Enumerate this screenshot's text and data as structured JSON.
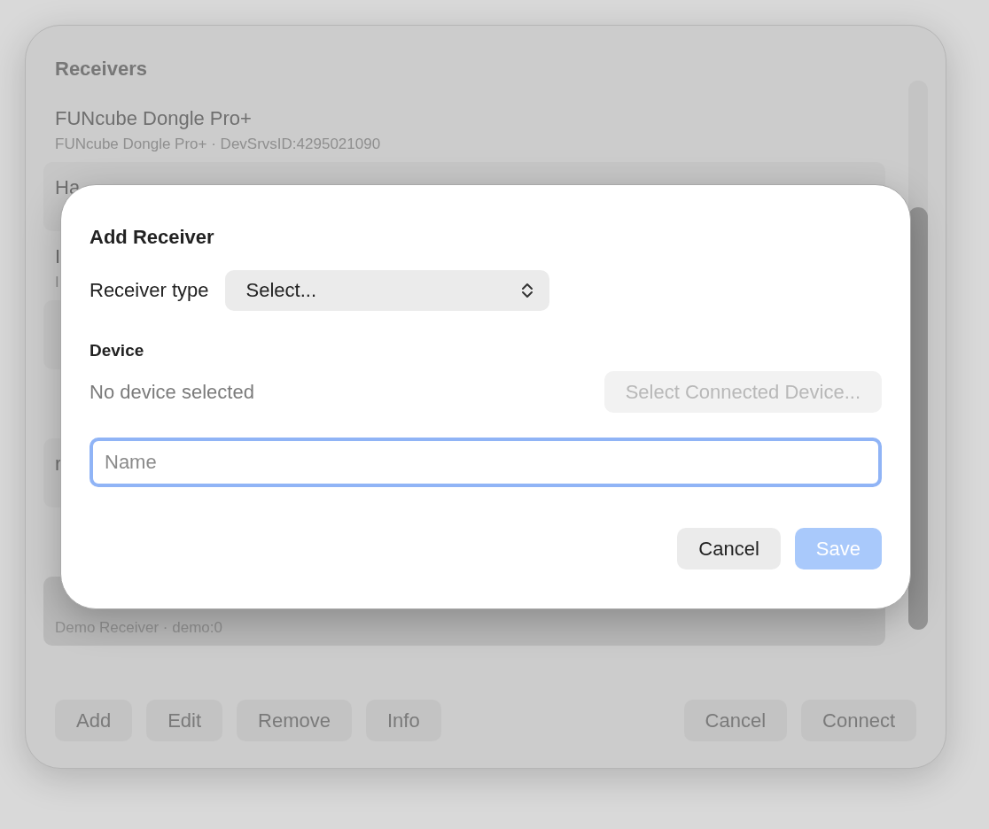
{
  "panel": {
    "title": "Receivers",
    "receivers": [
      {
        "title": "FUNcube Dongle Pro+",
        "subtitle": "FUNcube Dongle Pro+ · DevSrvsID:4295021090",
        "selected": false
      },
      {
        "title": "Ha",
        "selected": false
      },
      {
        "title": "I",
        "subtitle": "I",
        "selected": false
      },
      {
        "selected": false
      },
      {
        "selected": false
      },
      {
        "title": "r",
        "selected": false
      },
      {
        "selected": false
      },
      {
        "subtitle": "Demo Receiver · demo:0",
        "selected": true
      }
    ],
    "buttons_left": [
      "Add",
      "Edit",
      "Remove",
      "Info"
    ],
    "buttons_right": [
      "Cancel",
      "Connect"
    ]
  },
  "dialog": {
    "title": "Add Receiver",
    "receiver_type": {
      "label": "Receiver type",
      "value": "Select..."
    },
    "device": {
      "heading": "Device",
      "status": "No device selected",
      "button": {
        "label": "Select Connected Device...",
        "disabled": true
      }
    },
    "name_field": {
      "placeholder": "Name",
      "focused": true
    },
    "buttons": [
      {
        "label": "Cancel",
        "disabled": false,
        "primary": false
      },
      {
        "label": "Save",
        "disabled": true,
        "primary": true
      }
    ]
  }
}
